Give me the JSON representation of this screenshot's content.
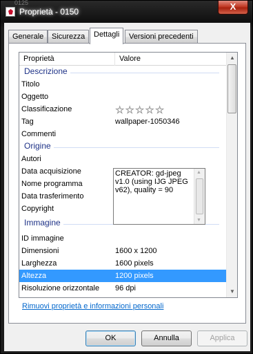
{
  "window": {
    "title": "Proprietà - 0150",
    "close_label": "X",
    "background_fragment": "0125"
  },
  "tabs": [
    {
      "label": "Generale"
    },
    {
      "label": "Sicurezza"
    },
    {
      "label": "Dettagli"
    },
    {
      "label": "Versioni precedenti"
    }
  ],
  "active_tab": "Dettagli",
  "list": {
    "columns": {
      "name": "Proprietà",
      "value": "Valore"
    },
    "groups": {
      "descrizione": "Descrizione",
      "origine": "Origine",
      "immagine": "Immagine"
    },
    "rows": {
      "titolo": {
        "name": "Titolo",
        "value": ""
      },
      "oggetto": {
        "name": "Oggetto",
        "value": ""
      },
      "classificazione": {
        "name": "Classificazione",
        "rating": 0,
        "max": 5
      },
      "tag": {
        "name": "Tag",
        "value": "wallpaper-1050346"
      },
      "commenti": {
        "name": "Commenti",
        "value": "CREATOR: gd-jpeg v1.0 (using IJG JPEG v62), quality = 90"
      },
      "autori": {
        "name": "Autori",
        "value": ""
      },
      "data_acquisizione": {
        "name": "Data acquisizione",
        "value": ""
      },
      "nome_programma": {
        "name": "Nome programma",
        "value": ""
      },
      "data_trasferimento": {
        "name": "Data trasferimento",
        "value": ""
      },
      "copyright": {
        "name": "Copyright",
        "value": ""
      },
      "id_immagine": {
        "name": "ID immagine",
        "value": ""
      },
      "dimensioni": {
        "name": "Dimensioni",
        "value": "1600 x 1200"
      },
      "larghezza": {
        "name": "Larghezza",
        "value": "1600 pixels"
      },
      "altezza": {
        "name": "Altezza",
        "value": "1200 pixels"
      },
      "risoluzione": {
        "name": "Risoluzione orizzontale",
        "value": "96 dpi"
      }
    },
    "selected_row": "Altezza"
  },
  "link": {
    "label": "Rimuovi proprietà e informazioni personali"
  },
  "buttons": {
    "ok": "OK",
    "cancel": "Annulla",
    "apply": "Applica"
  },
  "colors": {
    "selection": "#3399ff",
    "group_title": "#1e3287",
    "link": "#0066cc",
    "close": "#c23a25"
  }
}
